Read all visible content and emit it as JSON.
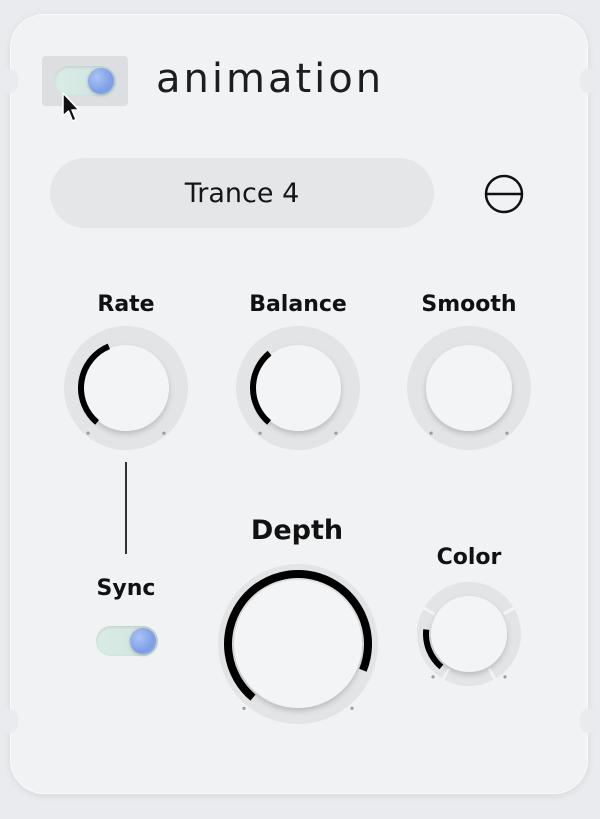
{
  "header": {
    "title": "animation",
    "toggle_on": true
  },
  "preset": {
    "name": "Trance 4"
  },
  "icons": {
    "menu": "circle-minus-icon",
    "cursor": "arrow-cursor-icon"
  },
  "knobs": {
    "rate": {
      "label": "Rate",
      "value": 0.42
    },
    "balance": {
      "label": "Balance",
      "value": 0.36
    },
    "smooth": {
      "label": "Smooth",
      "value": 0
    },
    "depth": {
      "label": "Depth",
      "value": 0.9
    },
    "color": {
      "label": "Color",
      "value": 0.2
    }
  },
  "sync": {
    "label": "Sync",
    "toggle_on": true
  },
  "colors": {
    "accent_knob": "#8aa7df",
    "arc": "#000000",
    "track": "#e3e4e6"
  }
}
